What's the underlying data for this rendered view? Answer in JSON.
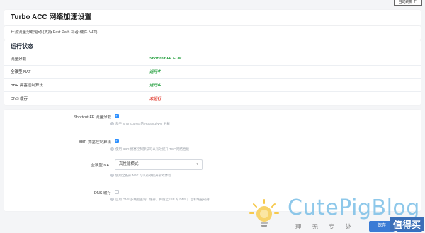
{
  "topbar": {
    "auto_refresh_label": "自动刷新 开"
  },
  "page": {
    "title": "Turbo ACC 网络加速设置",
    "description": "开源流量分载驱动 (支持 Fast Path 和者 硬件 NAT)"
  },
  "status": {
    "heading": "运行状态",
    "rows": [
      {
        "label": "流量分载",
        "value": "Shortcut-FE ECM",
        "color": "#1f9d3a"
      },
      {
        "label": "全锥型 NAT",
        "value": "运行中",
        "color": "#1f9d3a"
      },
      {
        "label": "BBR 拥塞控制算法",
        "value": "运行中",
        "color": "#1f9d3a"
      },
      {
        "label": "DNS 缓存",
        "value": "未运行",
        "color": "#e03b2f"
      }
    ]
  },
  "settings": {
    "sfe": {
      "label": "Shortcut-FE 流量分载",
      "checked": true,
      "help": "基于 Shortcut-FE 的 Routing/NAT 分载"
    },
    "bbr": {
      "label": "BBR 拥塞控制算法",
      "checked": true,
      "help": "使用 BBR 拥塞控制算法可以有效提升 TCP 网络性能"
    },
    "fullcone": {
      "label": "全锥型 NAT",
      "selected": "高性能模式",
      "help": "使用全锥形 NAT 可以有效提升游戏体验"
    },
    "dns": {
      "label": "DNS 缓存",
      "checked": false,
      "help": "启用 DNS 多线程查询、缓存，并防止 ISP 的 DNS 广告和域名劫持"
    }
  },
  "footer": {
    "buttons": [
      "保存",
      "保存并应用"
    ]
  },
  "watermark": {
    "brand": "CutePigBlog",
    "slogan": "理无专处",
    "tag": "值得买"
  },
  "colors": {
    "accent": "#2b8fff",
    "running": "#1f9d3a",
    "stopped": "#e03b2f"
  }
}
